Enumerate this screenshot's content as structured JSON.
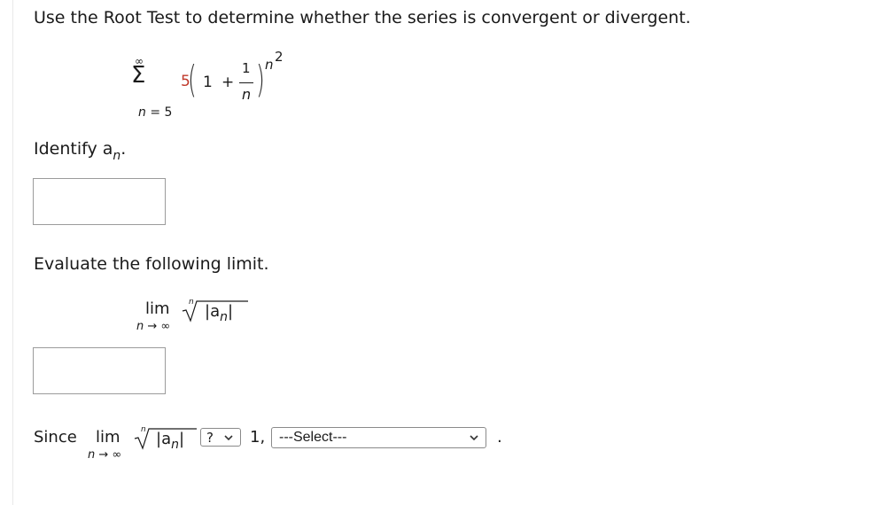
{
  "question": "Use the Root Test to determine whether the series is convergent or divergent.",
  "series": {
    "sum_upper": "∞",
    "sum_lower": "n = 5",
    "coefficient": "5",
    "one": "1",
    "plus": "+",
    "frac_num": "1",
    "frac_den": "n",
    "exponent_base": "n",
    "exponent_power": "2"
  },
  "part1": {
    "label": "Identify a",
    "sub": "n",
    "tail": ".",
    "answer": ""
  },
  "part2": {
    "label": "Evaluate the following limit.",
    "lim": "lim",
    "lim_sub": "n → ∞",
    "root_index": "n",
    "abs_open": "|a",
    "abs_sub": "n",
    "abs_close": "|",
    "answer": ""
  },
  "part3": {
    "since": "Since",
    "lim": "lim",
    "lim_sub": "n → ∞",
    "root_index": "n",
    "abs_open": "|a",
    "abs_sub": "n",
    "abs_close": "|",
    "comparison_value": "?",
    "one": "1,",
    "conclusion_value": "---Select---",
    "period": "."
  }
}
